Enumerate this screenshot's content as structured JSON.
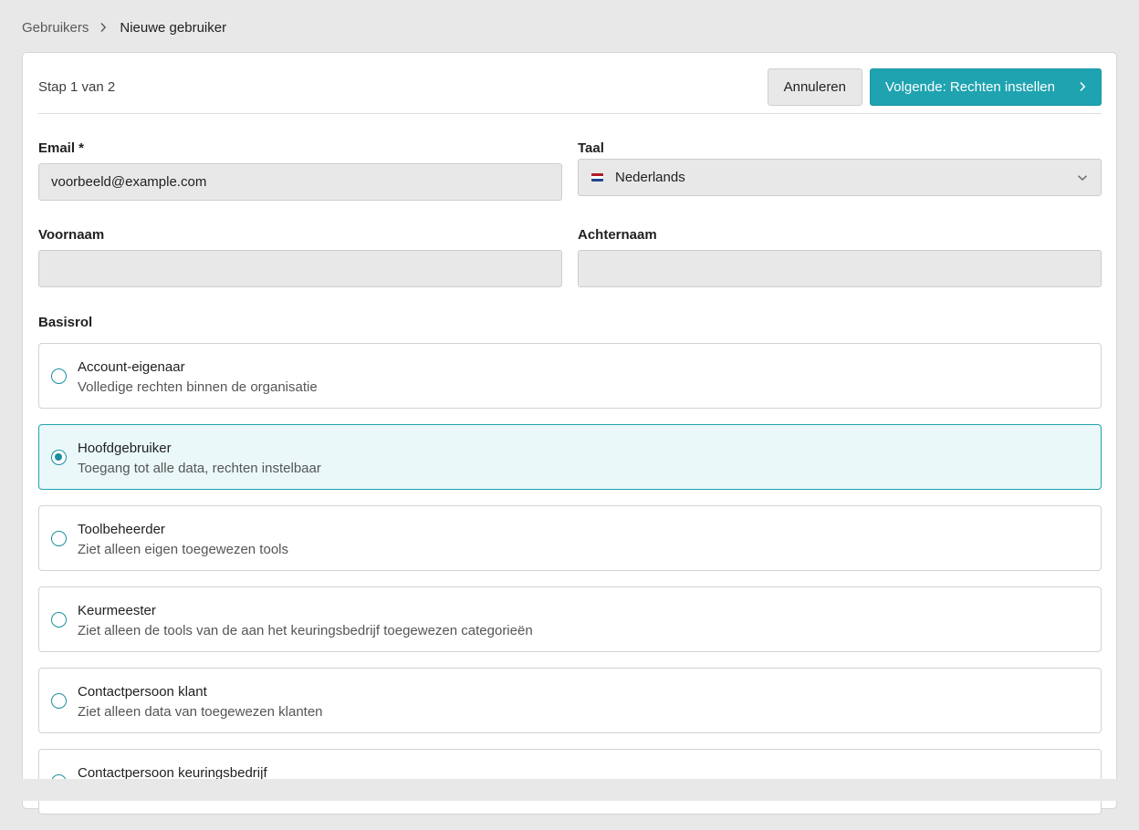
{
  "breadcrumb": {
    "parent": "Gebruikers",
    "separator_icon": "chevron-right-icon",
    "current": "Nieuwe gebruiker"
  },
  "header": {
    "step": "Stap 1 van 2",
    "cancel_label": "Annuleren",
    "next_label": "Volgende: Rechten instellen",
    "next_icon": "chevron-right-icon"
  },
  "form": {
    "email_label": "Email *",
    "email_value": "voorbeeld@example.com",
    "language_label": "Taal",
    "language_value": "Nederlands",
    "language_flag": "netherlands-flag-icon",
    "firstname_label": "Voornaam",
    "firstname_value": "",
    "lastname_label": "Achternaam",
    "lastname_value": ""
  },
  "roles": {
    "label": "Basisrol",
    "items": [
      {
        "title": "Account-eigenaar",
        "desc": "Volledige rechten binnen de organisatie",
        "selected": false
      },
      {
        "title": "Hoofdgebruiker",
        "desc": "Toegang tot alle data, rechten instelbaar",
        "selected": true
      },
      {
        "title": "Toolbeheerder",
        "desc": "Ziet alleen eigen toegewezen tools",
        "selected": false
      },
      {
        "title": "Keurmeester",
        "desc": "Ziet alleen de tools van de aan het keuringsbedrijf toegewezen categorieën",
        "selected": false
      },
      {
        "title": "Contactpersoon klant",
        "desc": "Ziet alleen data van toegewezen klanten",
        "selected": false
      },
      {
        "title": "Contactpersoon keuringsbedrijf",
        "desc": "",
        "selected": false
      }
    ]
  },
  "colors": {
    "accent": "#1fa3b0",
    "selected_bg": "#eaf8f9",
    "page_bg": "#e8e8e8"
  }
}
